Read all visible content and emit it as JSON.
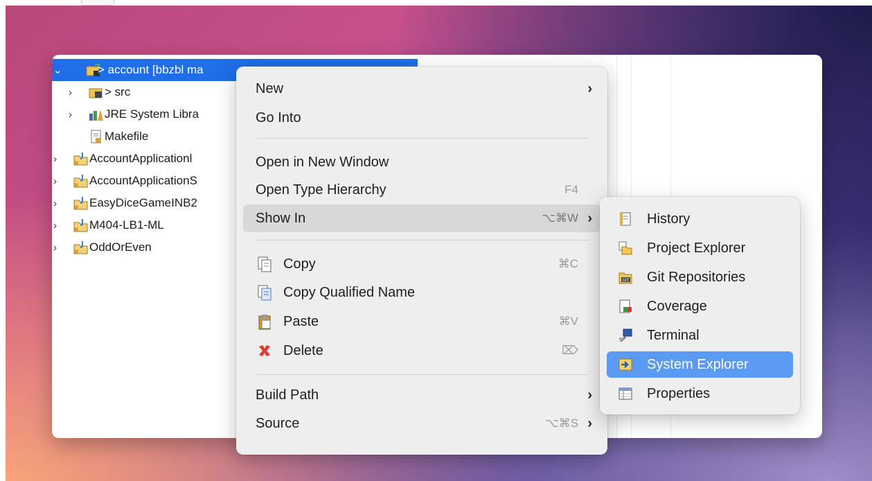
{
  "tree": {
    "rows": [
      {
        "label": "> account [bbzbl ma"
      },
      {
        "label": "> src"
      },
      {
        "label": "JRE System Libra"
      },
      {
        "label": "Makefile"
      },
      {
        "label": "AccountApplicationl"
      },
      {
        "label": "AccountApplicationS"
      },
      {
        "label": "EasyDiceGameINB2"
      },
      {
        "label": "M404-LB1-ML"
      },
      {
        "label": "OddOrEven"
      }
    ]
  },
  "context_menu": {
    "items": [
      {
        "label": "New",
        "shortcut": "",
        "submenu": true
      },
      {
        "label": "Go Into",
        "shortcut": ""
      },
      {
        "label": "Open in New Window",
        "shortcut": ""
      },
      {
        "label": "Open Type Hierarchy",
        "shortcut": "F4"
      },
      {
        "label": "Show In",
        "shortcut": "⌥⌘W",
        "submenu": true
      },
      {
        "label": "Copy",
        "shortcut": "⌘C",
        "icon": "copy-icon"
      },
      {
        "label": "Copy Qualified Name",
        "shortcut": "",
        "icon": "copy-qualified-icon"
      },
      {
        "label": "Paste",
        "shortcut": "⌘V",
        "icon": "paste-icon"
      },
      {
        "label": "Delete",
        "shortcut": "⌦",
        "icon": "delete-icon"
      },
      {
        "label": "Build Path",
        "shortcut": "",
        "submenu": true
      },
      {
        "label": "Source",
        "shortcut": "⌥⌘S",
        "submenu": true
      }
    ]
  },
  "show_in_submenu": {
    "items": [
      {
        "label": "History",
        "icon": "history-icon"
      },
      {
        "label": "Project Explorer",
        "icon": "project-explorer-icon"
      },
      {
        "label": "Git Repositories",
        "icon": "git-repositories-icon"
      },
      {
        "label": "Coverage",
        "icon": "coverage-icon"
      },
      {
        "label": "Terminal",
        "icon": "terminal-icon"
      },
      {
        "label": "System Explorer",
        "icon": "system-explorer-icon",
        "selected": true
      },
      {
        "label": "Properties",
        "icon": "properties-icon"
      }
    ]
  },
  "colors": {
    "selection": "#1f6ee8",
    "submenu_selection": "#5a9af2",
    "delete_red": "#e03a2e"
  }
}
